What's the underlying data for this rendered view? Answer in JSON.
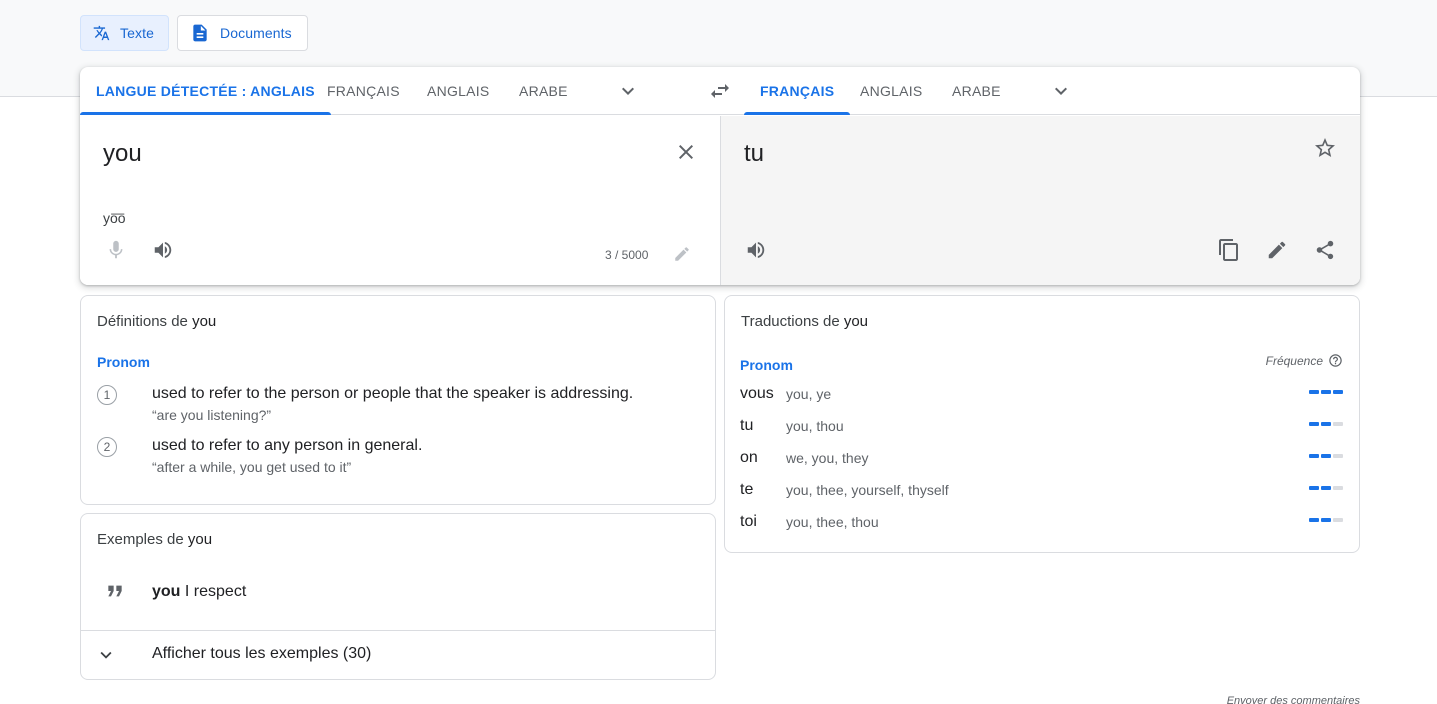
{
  "modes": {
    "text_label": "Texte",
    "documents_label": "Documents"
  },
  "source_languages": {
    "detected": "LANGUE DÉTECTÉE : ANGLAIS",
    "items": [
      "FRANÇAIS",
      "ANGLAIS",
      "ARABE"
    ]
  },
  "target_languages": {
    "selected": "FRANÇAIS",
    "items": [
      "ANGLAIS",
      "ARABE"
    ]
  },
  "source": {
    "text": "you",
    "transliteration": "yo͞o",
    "counter": "3 / 5000"
  },
  "target": {
    "text": "tu"
  },
  "definitions": {
    "title_prefix": "Définitions de",
    "title_word": "you",
    "pos": "Pronom",
    "items": [
      {
        "num": "1",
        "text": "used to refer to the person or people that the speaker is addressing.",
        "example": "“are you listening?”"
      },
      {
        "num": "2",
        "text": "used to refer to any person in general.",
        "example": "“after a while, you get used to it”"
      }
    ]
  },
  "examples": {
    "title_prefix": "Exemples de",
    "title_word": "you",
    "quote_highlight": "you",
    "quote_rest": " I respect",
    "show_all": "Afficher tous les exemples (30)"
  },
  "translations": {
    "title_prefix": "Traductions de",
    "title_word": "you",
    "pos": "Pronom",
    "frequency_label": "Fréquence",
    "rows": [
      {
        "word": "vous",
        "synonyms": "you, ye",
        "freq": 3
      },
      {
        "word": "tu",
        "synonyms": "you, thou",
        "freq": 2
      },
      {
        "word": "on",
        "synonyms": "we, you, they",
        "freq": 2
      },
      {
        "word": "te",
        "synonyms": "you, thee, yourself, thyself",
        "freq": 2
      },
      {
        "word": "toi",
        "synonyms": "you, thee, thou",
        "freq": 2
      }
    ]
  },
  "footer": {
    "feedback": "Envoyer des commentaires"
  },
  "colors": {
    "accent": "#1a73e8",
    "text": "#202124",
    "muted": "#5f6368"
  }
}
